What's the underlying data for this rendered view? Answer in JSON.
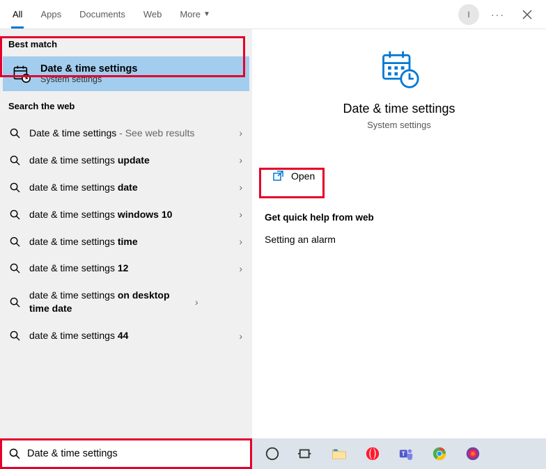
{
  "header": {
    "tabs": [
      {
        "label": "All",
        "active": true
      },
      {
        "label": "Apps",
        "active": false
      },
      {
        "label": "Documents",
        "active": false
      },
      {
        "label": "Web",
        "active": false
      },
      {
        "label": "More",
        "active": false,
        "chevron": true
      }
    ],
    "avatar_initial": "I"
  },
  "left": {
    "best_match_label": "Best match",
    "best_item": {
      "title": "Date & time settings",
      "subtitle": "System settings"
    },
    "web_label": "Search the web",
    "web_items": [
      {
        "prefix": "Date & time settings",
        "suffix": " - See web results",
        "bold_suffix": ""
      },
      {
        "prefix": "date & time settings ",
        "suffix": "",
        "bold_suffix": "update"
      },
      {
        "prefix": "date & time settings ",
        "suffix": "",
        "bold_suffix": "date"
      },
      {
        "prefix": "date & time settings ",
        "suffix": "",
        "bold_suffix": "windows 10"
      },
      {
        "prefix": "date & time settings ",
        "suffix": "",
        "bold_suffix": "time"
      },
      {
        "prefix": "date & time settings ",
        "suffix": "",
        "bold_suffix": "12"
      },
      {
        "prefix": "date & time settings ",
        "suffix": "",
        "bold_suffix": "on desktop time date"
      },
      {
        "prefix": "date & time settings ",
        "suffix": "",
        "bold_suffix": "44"
      }
    ]
  },
  "right": {
    "title": "Date & time settings",
    "subtitle": "System settings",
    "open_label": "Open",
    "quick_help_heading": "Get quick help from web",
    "quick_links": [
      "Setting an alarm"
    ]
  },
  "search": {
    "value": "Date & time settings"
  }
}
